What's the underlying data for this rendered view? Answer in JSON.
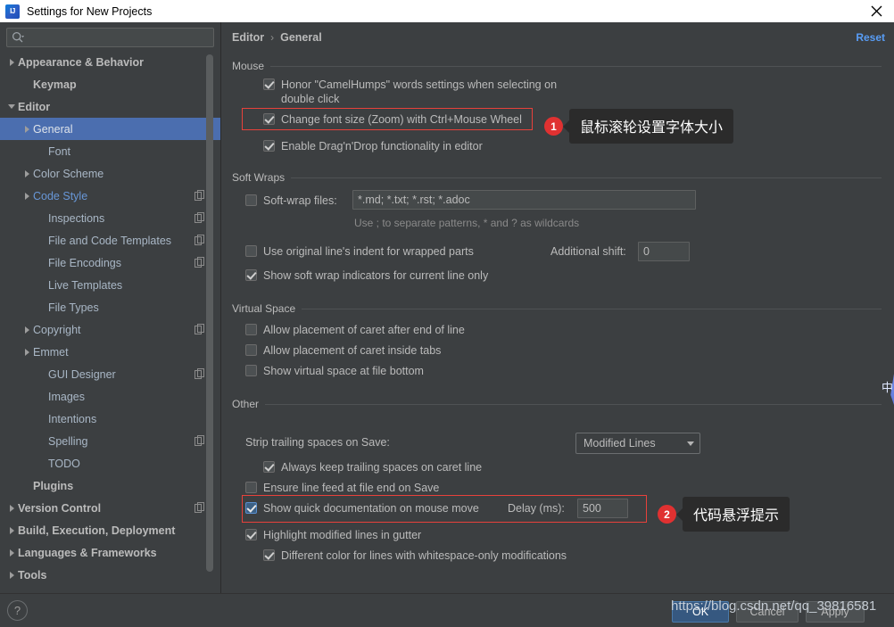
{
  "window": {
    "title": "Settings for New Projects",
    "logo_icon": "intellij-idea-logo",
    "close_icon": "close-icon"
  },
  "search": {
    "value": "",
    "placeholder": "",
    "icon": "search-icon"
  },
  "sidebar": {
    "items": [
      {
        "label": "Appearance & Behavior",
        "indent": 0,
        "arrow": "right",
        "bold": true,
        "modified": false,
        "copy": false,
        "selected": false
      },
      {
        "label": "Keymap",
        "indent": 1,
        "arrow": "none",
        "bold": true,
        "modified": false,
        "copy": false,
        "selected": false
      },
      {
        "label": "Editor",
        "indent": 0,
        "arrow": "down",
        "bold": true,
        "modified": false,
        "copy": false,
        "selected": false
      },
      {
        "label": "General",
        "indent": 1,
        "arrow": "right",
        "bold": false,
        "modified": false,
        "copy": false,
        "selected": true
      },
      {
        "label": "Font",
        "indent": 2,
        "arrow": "none",
        "bold": false,
        "modified": false,
        "copy": false,
        "selected": false
      },
      {
        "label": "Color Scheme",
        "indent": 1,
        "arrow": "right",
        "bold": false,
        "modified": false,
        "copy": false,
        "selected": false
      },
      {
        "label": "Code Style",
        "indent": 1,
        "arrow": "right",
        "bold": false,
        "modified": true,
        "copy": true,
        "selected": false
      },
      {
        "label": "Inspections",
        "indent": 2,
        "arrow": "none",
        "bold": false,
        "modified": false,
        "copy": true,
        "selected": false
      },
      {
        "label": "File and Code Templates",
        "indent": 2,
        "arrow": "none",
        "bold": false,
        "modified": false,
        "copy": true,
        "selected": false
      },
      {
        "label": "File Encodings",
        "indent": 2,
        "arrow": "none",
        "bold": false,
        "modified": false,
        "copy": true,
        "selected": false
      },
      {
        "label": "Live Templates",
        "indent": 2,
        "arrow": "none",
        "bold": false,
        "modified": false,
        "copy": false,
        "selected": false
      },
      {
        "label": "File Types",
        "indent": 2,
        "arrow": "none",
        "bold": false,
        "modified": false,
        "copy": false,
        "selected": false
      },
      {
        "label": "Copyright",
        "indent": 1,
        "arrow": "right",
        "bold": false,
        "modified": false,
        "copy": true,
        "selected": false
      },
      {
        "label": "Emmet",
        "indent": 1,
        "arrow": "right",
        "bold": false,
        "modified": false,
        "copy": false,
        "selected": false
      },
      {
        "label": "GUI Designer",
        "indent": 2,
        "arrow": "none",
        "bold": false,
        "modified": false,
        "copy": true,
        "selected": false
      },
      {
        "label": "Images",
        "indent": 2,
        "arrow": "none",
        "bold": false,
        "modified": false,
        "copy": false,
        "selected": false
      },
      {
        "label": "Intentions",
        "indent": 2,
        "arrow": "none",
        "bold": false,
        "modified": false,
        "copy": false,
        "selected": false
      },
      {
        "label": "Spelling",
        "indent": 2,
        "arrow": "none",
        "bold": false,
        "modified": false,
        "copy": true,
        "selected": false
      },
      {
        "label": "TODO",
        "indent": 2,
        "arrow": "none",
        "bold": false,
        "modified": false,
        "copy": false,
        "selected": false
      },
      {
        "label": "Plugins",
        "indent": 1,
        "arrow": "none",
        "bold": true,
        "modified": false,
        "copy": false,
        "selected": false
      },
      {
        "label": "Version Control",
        "indent": 0,
        "arrow": "right",
        "bold": true,
        "modified": false,
        "copy": true,
        "selected": false
      },
      {
        "label": "Build, Execution, Deployment",
        "indent": 0,
        "arrow": "right",
        "bold": true,
        "modified": false,
        "copy": false,
        "selected": false
      },
      {
        "label": "Languages & Frameworks",
        "indent": 0,
        "arrow": "right",
        "bold": true,
        "modified": false,
        "copy": false,
        "selected": false
      },
      {
        "label": "Tools",
        "indent": 0,
        "arrow": "right",
        "bold": true,
        "modified": false,
        "copy": false,
        "selected": false
      }
    ]
  },
  "main": {
    "breadcrumb": {
      "parent": "Editor",
      "separator": "›",
      "current": "General"
    },
    "reset_label": "Reset",
    "groups": {
      "mouse": {
        "title": "Mouse",
        "honor_camelhumps": "Honor \"CamelHumps\" words settings when selecting on double click",
        "change_font_size": "Change font size (Zoom) with Ctrl+Mouse Wheel",
        "enable_dragndrop": "Enable Drag'n'Drop functionality in editor"
      },
      "soft_wraps": {
        "title": "Soft Wraps",
        "soft_wrap_files_label": "Soft-wrap files:",
        "soft_wrap_files_value": "*.md; *.txt; *.rst; *.adoc",
        "hint": "Use ; to separate patterns, * and ? as wildcards",
        "use_original_indent": "Use original line's indent for wrapped parts",
        "additional_shift_label": "Additional shift:",
        "additional_shift_value": "0",
        "show_indicators": "Show soft wrap indicators for current line only"
      },
      "virtual_space": {
        "title": "Virtual Space",
        "caret_after_eol": "Allow placement of caret after end of line",
        "caret_inside_tabs": "Allow placement of caret inside tabs",
        "virtual_space_bottom": "Show virtual space at file bottom"
      },
      "other": {
        "title": "Other",
        "strip_trailing_label": "Strip trailing spaces on Save:",
        "strip_trailing_value": "Modified Lines",
        "always_keep_trailing": "Always keep trailing spaces on caret line",
        "ensure_line_feed": "Ensure line feed at file end on Save",
        "show_quick_doc": "Show quick documentation on mouse move",
        "delay_label": "Delay (ms):",
        "delay_value": "500",
        "highlight_modified": "Highlight modified lines in gutter",
        "different_color": "Different color for lines with whitespace-only modifications"
      }
    }
  },
  "annotations": [
    {
      "number": "1",
      "text": "鼠标滚轮设置字体大小"
    },
    {
      "number": "2",
      "text": "代码悬浮提示"
    }
  ],
  "footer": {
    "help_label": "?",
    "ok_label": "OK",
    "cancel_label": "Cancel",
    "apply_label": "Apply",
    "watermark": "https://blog.csdn.net/qq_39816581"
  },
  "colors": {
    "accent_selection": "#4b6eaf",
    "link": "#589df6",
    "highlight_box": "#e8413b",
    "badge": "#e03131",
    "primary_button": "#365880",
    "modified_node": "#6897d7"
  }
}
